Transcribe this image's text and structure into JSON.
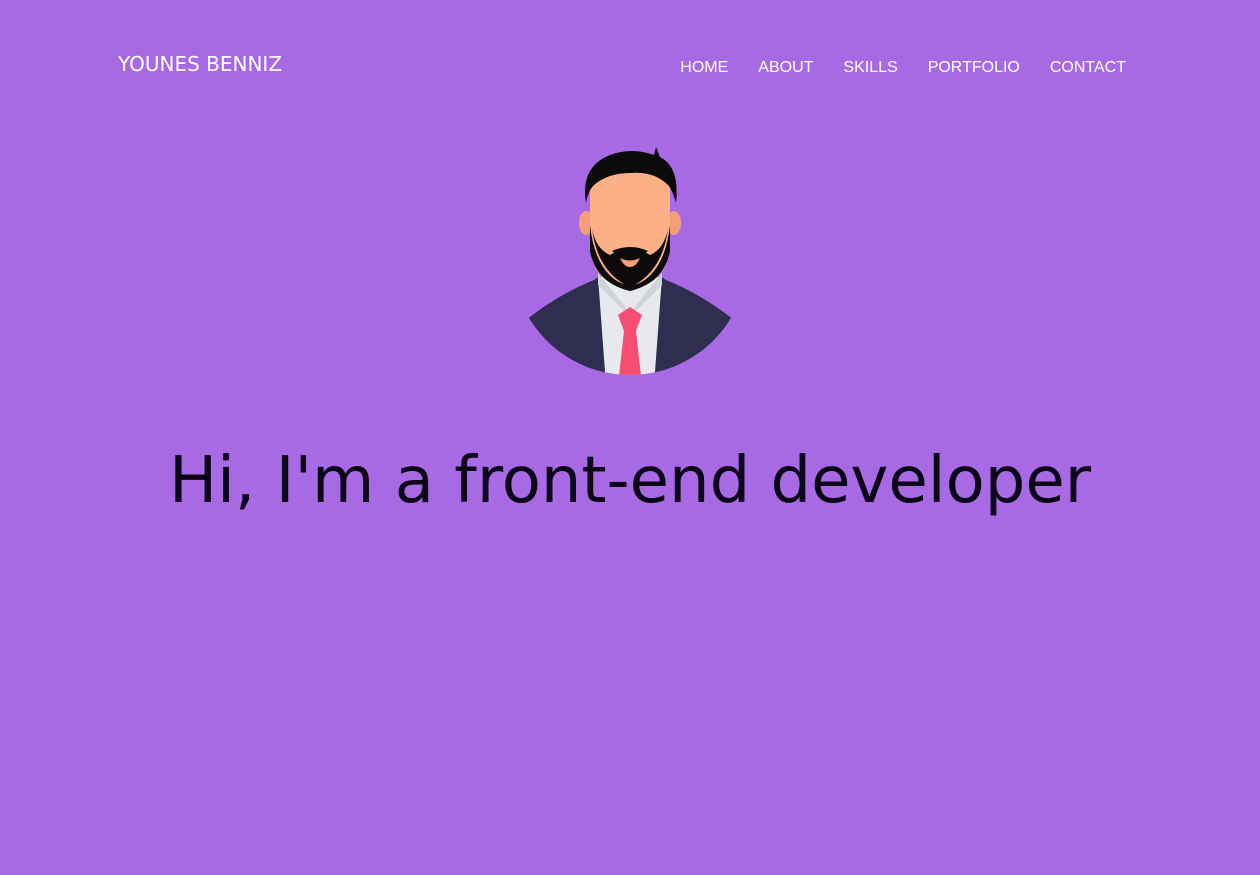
{
  "brand": {
    "name": "YOUNES BENNIZ"
  },
  "nav": {
    "items": [
      {
        "label": "HOME"
      },
      {
        "label": "ABOUT"
      },
      {
        "label": "SKILLS"
      },
      {
        "label": "PORTFOLIO"
      },
      {
        "label": "CONTACT"
      }
    ]
  },
  "hero": {
    "avatar_icon": "bearded-man-avatar",
    "headline": "Hi, I'm a front-end developer"
  },
  "colors": {
    "background": "#a869e4",
    "nav_text": "#ffffff",
    "headline_text": "#0b0517",
    "suit": "#2f2e50",
    "tie": "#f74d73",
    "skin": "#fcb087",
    "hair": "#0d0a0b"
  }
}
